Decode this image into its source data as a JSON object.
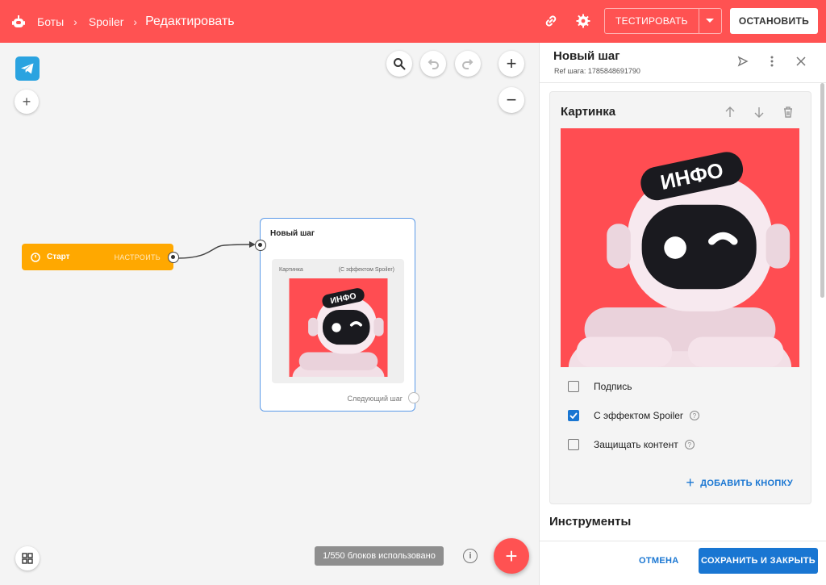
{
  "topbar": {
    "bot_icon": "robot-icon",
    "breadcrumb": [
      "Боты",
      "Spoiler"
    ],
    "current": "Редактировать",
    "link_icon": "link-icon",
    "settings_icon": "gear-icon",
    "test_label": "ТЕСТИРОВАТЬ",
    "stop_label": "ОСТАНОВИТЬ"
  },
  "canvas": {
    "start_node": {
      "label": "Старт",
      "configure": "НАСТРОИТЬ"
    },
    "step_node": {
      "title": "Новый шаг",
      "block_label": "Картинка",
      "block_note": "(С эффектом Spoiler)",
      "next_label": "Следующий шаг"
    },
    "counter": "1/550 блоков использовано",
    "image_badge": "ИНФО"
  },
  "panel": {
    "title": "Новый шаг",
    "ref": "Ref шага: 1785848691790",
    "card_title": "Картинка",
    "options": [
      {
        "label": "Подпись",
        "checked": false,
        "help": false
      },
      {
        "label": "С эффектом Spoiler",
        "checked": true,
        "help": true
      },
      {
        "label": "Защищать контент",
        "checked": false,
        "help": true
      }
    ],
    "add_button": "ДОБАВИТЬ КНОПКУ",
    "tools_title": "Инструменты",
    "cancel": "ОТМЕНА",
    "save": "СОХРАНИТЬ И ЗАКРЫТЬ"
  },
  "colors": {
    "brand": "#ff5252",
    "accent": "#1976d2",
    "start": "#ffa800",
    "telegram": "#2aa3e0"
  }
}
